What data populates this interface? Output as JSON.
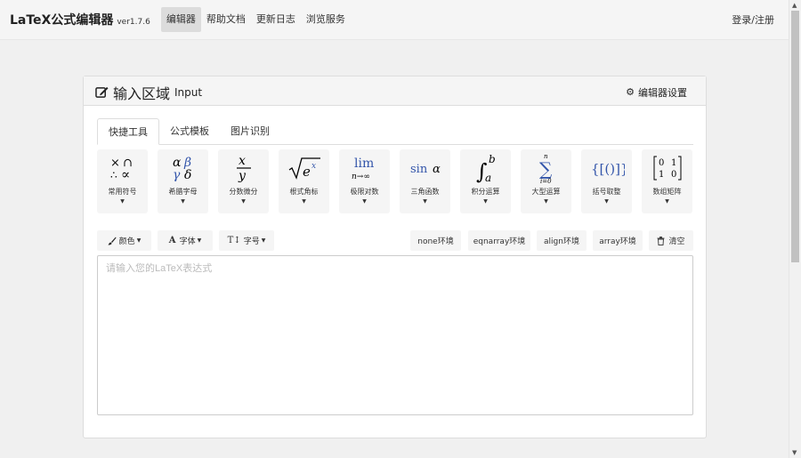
{
  "brand": {
    "name": "LaTeX公式编辑器",
    "version": "ver1.7.6"
  },
  "nav": [
    {
      "label": "编辑器",
      "active": true
    },
    {
      "label": "帮助文档",
      "active": false
    },
    {
      "label": "更新日志",
      "active": false
    },
    {
      "label": "浏览服务",
      "active": false
    }
  ],
  "auth": {
    "login_label": "登录/注册"
  },
  "panel": {
    "title": "输入区域",
    "title_en": "Input",
    "settings_label": "编辑器设置"
  },
  "tabs": [
    {
      "label": "快捷工具",
      "active": true
    },
    {
      "label": "公式模板",
      "active": false
    },
    {
      "label": "图片识别",
      "active": false
    }
  ],
  "symbols": [
    {
      "label": "常用符号",
      "icon": "common-symbols-icon"
    },
    {
      "label": "希腊字母",
      "icon": "greek-letters-icon"
    },
    {
      "label": "分数微分",
      "icon": "fraction-icon"
    },
    {
      "label": "根式角标",
      "icon": "radical-icon"
    },
    {
      "label": "极限对数",
      "icon": "limit-icon"
    },
    {
      "label": "三角函数",
      "icon": "trig-icon"
    },
    {
      "label": "积分运算",
      "icon": "integral-icon"
    },
    {
      "label": "大型运算",
      "icon": "sum-icon"
    },
    {
      "label": "括号取整",
      "icon": "brackets-icon"
    },
    {
      "label": "数组矩阵",
      "icon": "matrix-icon"
    }
  ],
  "format": {
    "color_label": "颜色",
    "font_label": "字体",
    "size_label": "字号"
  },
  "environments": [
    {
      "label": "none环境"
    },
    {
      "label": "eqnarray环境"
    },
    {
      "label": "align环境"
    },
    {
      "label": "array环境"
    }
  ],
  "clear_label": "清空",
  "editor": {
    "placeholder": "请输入您的LaTeX表达式",
    "value": ""
  }
}
